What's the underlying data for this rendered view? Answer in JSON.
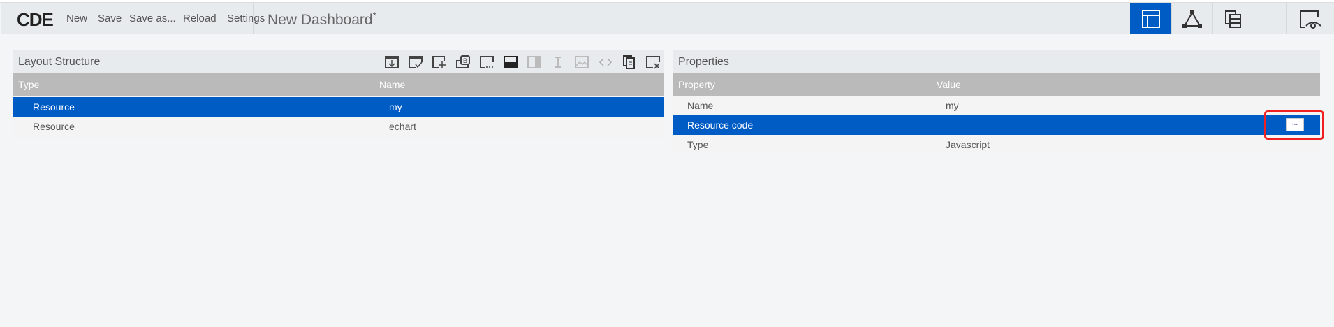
{
  "topbar": {
    "logo": "CDE",
    "menu": [
      "New",
      "Save",
      "Save as...",
      "Reload",
      "Settings"
    ],
    "title": "New Dashboard",
    "modified_mark": "*",
    "view_buttons": [
      {
        "icon": "layout-icon",
        "active": true
      },
      {
        "icon": "components-icon",
        "active": false
      },
      {
        "icon": "datasources-icon",
        "active": false
      },
      {
        "icon": "preview-icon",
        "active": false
      }
    ]
  },
  "layout": {
    "title": "Layout Structure",
    "toolbar": [
      "save-template-icon",
      "apply-template-icon",
      "add-resource-icon",
      "add-bootstrap-panel-icon",
      "add-freeform-icon",
      "add-row-icon",
      "add-column-icon",
      "add-space-icon",
      "add-image-icon",
      "add-html-icon",
      "duplicate-icon",
      "delete-icon"
    ],
    "columns": [
      "Type",
      "Name"
    ],
    "rows": [
      {
        "type": "Resource",
        "name": "my",
        "selected": true
      },
      {
        "type": "Resource",
        "name": "echart",
        "selected": false
      }
    ]
  },
  "properties": {
    "title": "Properties",
    "columns": [
      "Property",
      "Value"
    ],
    "rows": [
      {
        "property": "Name",
        "value": "my",
        "selected": false
      },
      {
        "property": "Resource code",
        "value": "",
        "selected": true,
        "button": "..."
      },
      {
        "property": "Type",
        "value": "Javascript",
        "selected": false
      }
    ]
  },
  "colors": {
    "accent": "#005cc5",
    "highlight": "#f02020"
  }
}
